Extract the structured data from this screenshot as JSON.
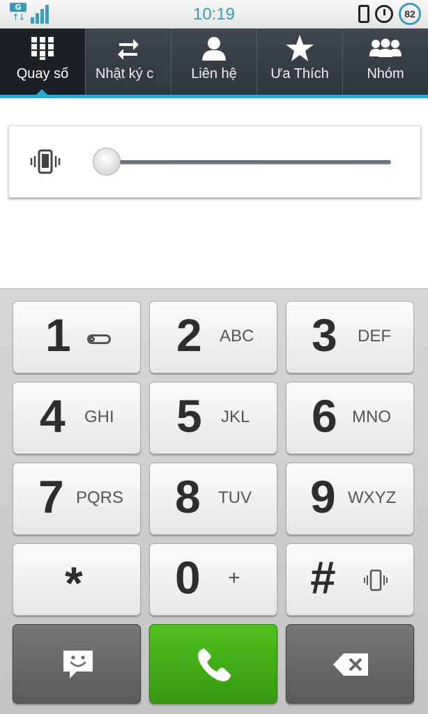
{
  "status_bar": {
    "network": "G",
    "time": "10:19",
    "battery": "82",
    "icons": [
      "network-type-icon",
      "signal-bars-icon",
      "vibrate-mode-icon",
      "alarm-icon",
      "battery-icon"
    ]
  },
  "tabs": [
    {
      "label": "Quay số",
      "icon": "dialpad-icon",
      "active": true
    },
    {
      "label": "Nhật ký c",
      "icon": "call-log-icon",
      "active": false
    },
    {
      "label": "Liên hệ",
      "icon": "contact-icon",
      "active": false
    },
    {
      "label": "Ưa Thích",
      "icon": "star-icon",
      "active": false
    },
    {
      "label": "Nhóm",
      "icon": "groups-icon",
      "active": false
    }
  ],
  "volume": {
    "icon": "vibrate-icon",
    "level": 0.0
  },
  "keypad": {
    "keys": [
      {
        "digit": "1",
        "letters": "",
        "icon": "voicemail-icon"
      },
      {
        "digit": "2",
        "letters": "ABC"
      },
      {
        "digit": "3",
        "letters": "DEF"
      },
      {
        "digit": "4",
        "letters": "GHI"
      },
      {
        "digit": "5",
        "letters": "JKL"
      },
      {
        "digit": "6",
        "letters": "MNO"
      },
      {
        "digit": "7",
        "letters": "PQRS"
      },
      {
        "digit": "8",
        "letters": "TUV"
      },
      {
        "digit": "9",
        "letters": "WXYZ"
      },
      {
        "digit": "*",
        "letters": ""
      },
      {
        "digit": "0",
        "letters": "+"
      },
      {
        "digit": "#",
        "letters": "",
        "icon": "vibrate-small-icon"
      }
    ],
    "actions": [
      "message-icon",
      "call-icon",
      "backspace-icon"
    ]
  },
  "colors": {
    "accent": "#2aa9d6",
    "tabbar": "#353b44",
    "call_green": "#3fae17",
    "status_text": "#3a9ab8"
  }
}
